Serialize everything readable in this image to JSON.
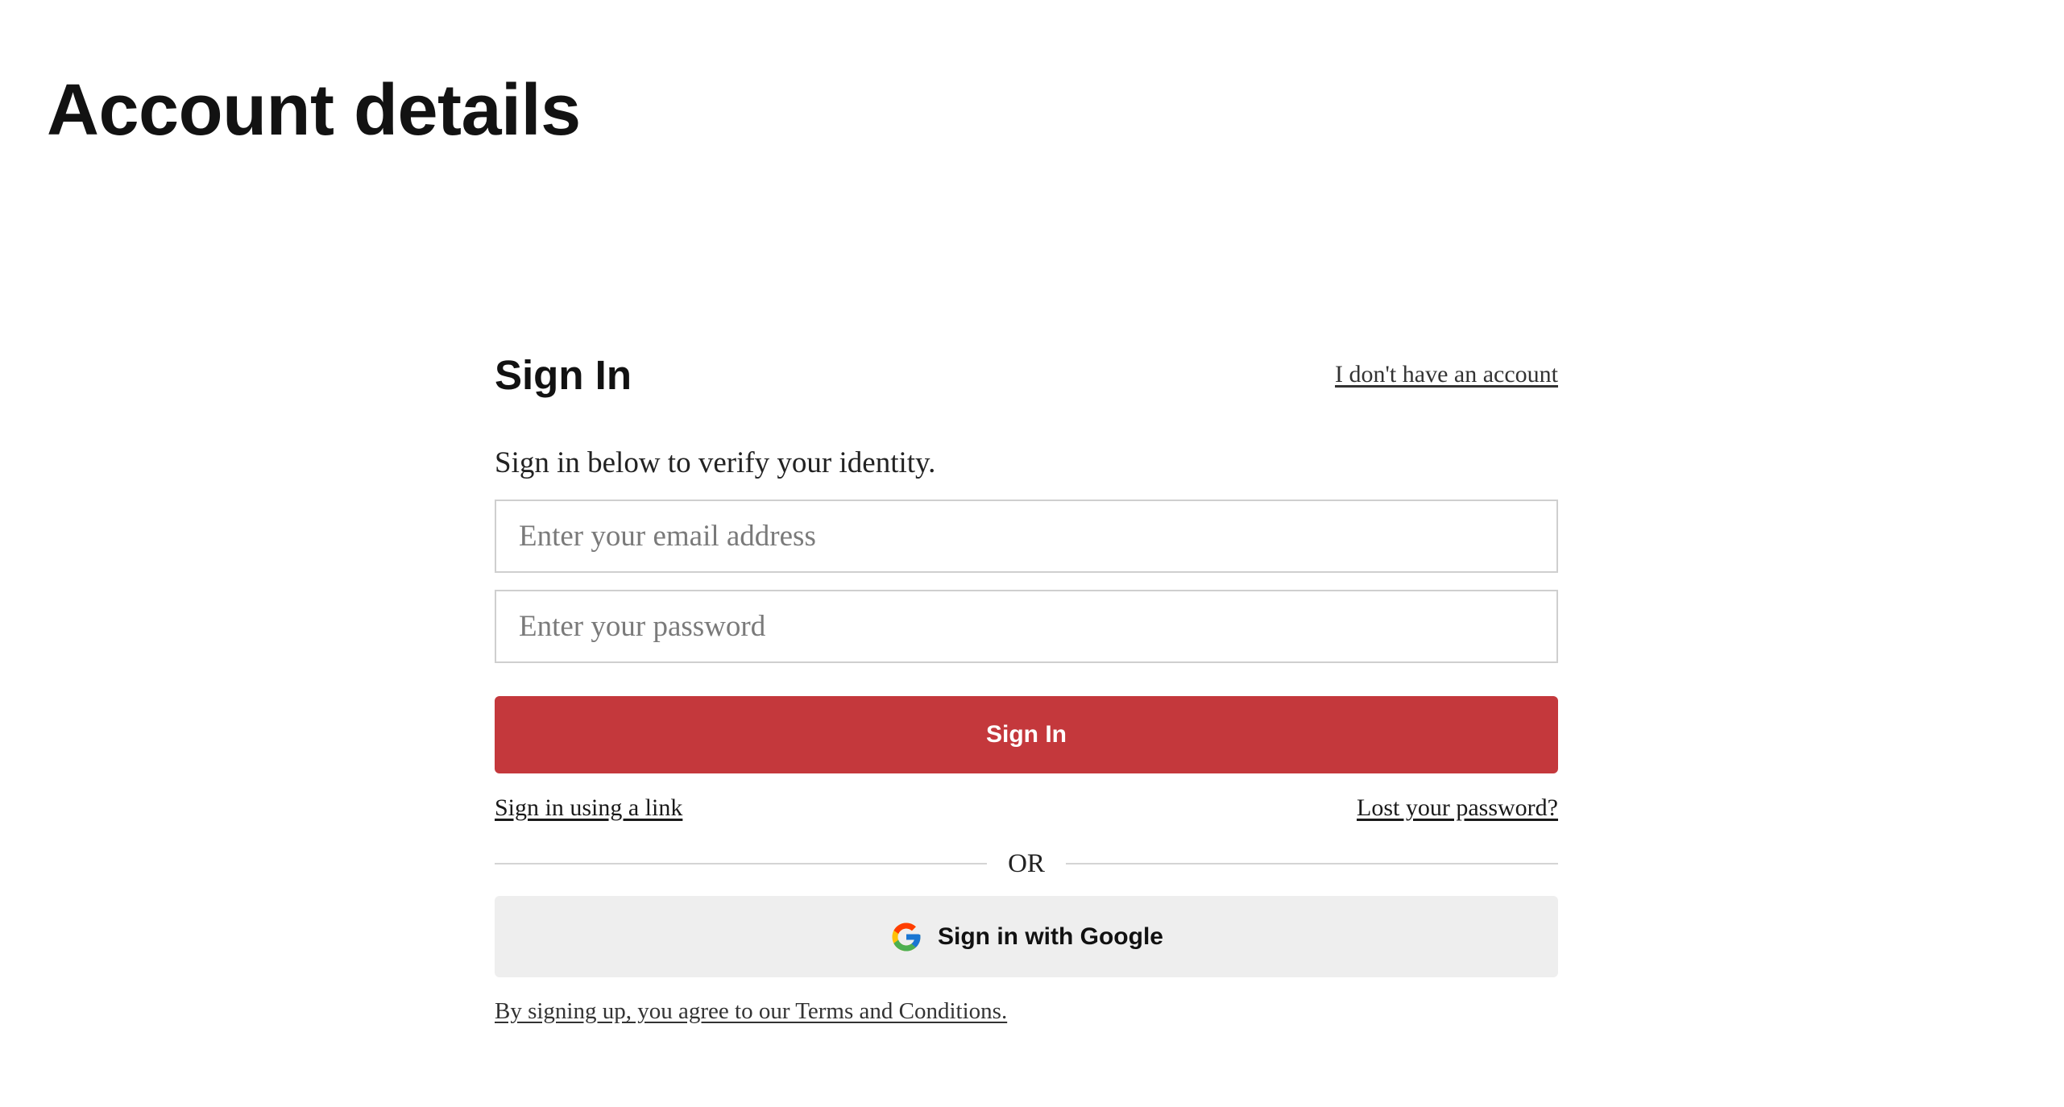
{
  "page": {
    "title": "Account details"
  },
  "signin": {
    "title": "Sign In",
    "no_account_link": "I don't have an account",
    "intro": "Sign in below to verify your identity.",
    "email_placeholder": "Enter your email address",
    "email_value": "",
    "password_placeholder": "Enter your password",
    "password_value": "",
    "submit_label": "Sign In",
    "submit_color": "#c4383c",
    "link_signin_label": "Sign in using a link",
    "lost_password_label": "Lost your password?",
    "divider_label": "OR",
    "google_label": "Sign in with Google",
    "google_icon": "google-g-icon",
    "terms_label": "By signing up, you agree to our Terms and Conditions."
  }
}
